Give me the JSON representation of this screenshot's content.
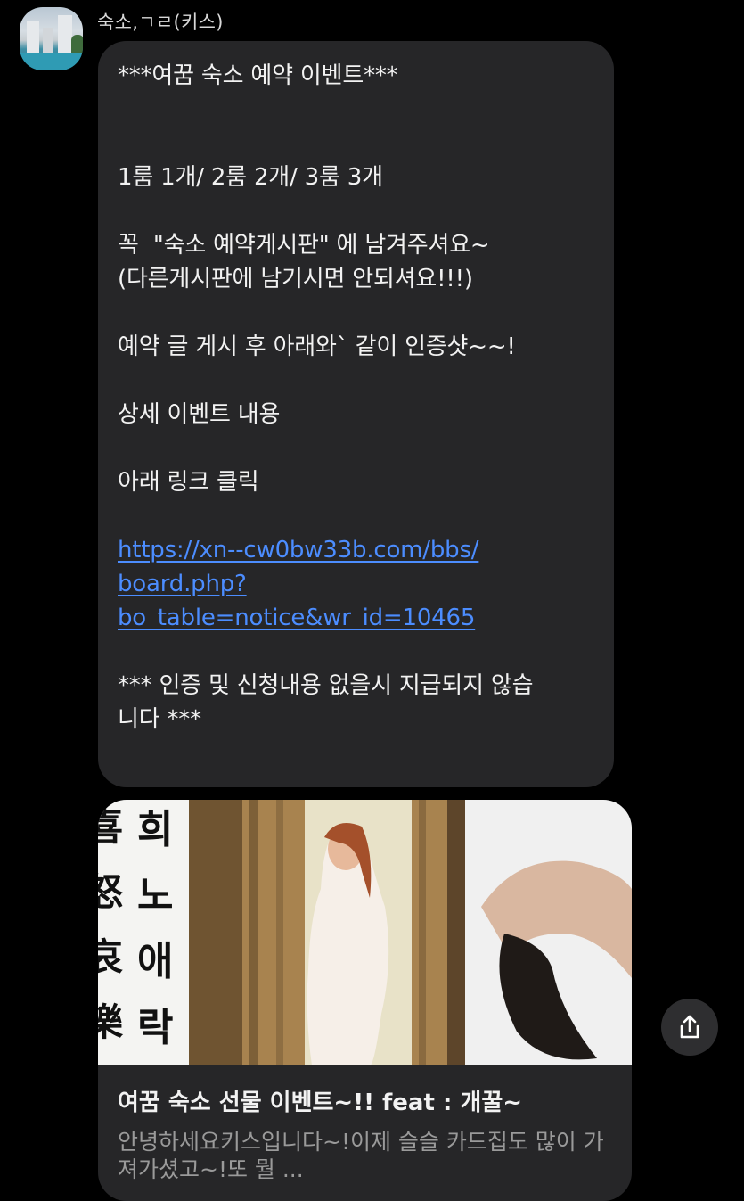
{
  "sender": {
    "name": "숙소,ㄱㄹ(키스)"
  },
  "message": {
    "title": "***여꿈 숙소 예약 이벤트***",
    "rooms": "1룸 1개/ 2룸 2개/ 3룸 3개",
    "instruction_1": "꼭  \"숙소 예약게시판\" 에 남겨주셔요~",
    "instruction_2": "(다른게시판에 남기시면 안되셔요!!!)",
    "instruction_3": "예약 글 게시 후 아래와` 같이 인증샷~~!",
    "details": "상세 이벤트 내용",
    "click": "아래 링크 클릭",
    "link_line_1": "https://xn--cw0bw33b.com/bbs/",
    "link_line_2": "board.php?",
    "link_line_3": "bo_table=notice&wr_id=10465",
    "notice_line_1": "*** 인증 및 신청내용 없을시 지급되지 않습",
    "notice_line_2": "니다 ***"
  },
  "link_preview": {
    "calligraphy_left": [
      "喜",
      "怒",
      "哀",
      "樂"
    ],
    "calligraphy_right": [
      "희",
      "노",
      "애",
      "락"
    ],
    "title": "여꿈 숙소 선물 이벤트~!! feat : 개꿀~",
    "description": "안녕하세요키스입니다~!이제 슬슬 카드집도 많이 가져가셨고~!또 뭘 ..."
  },
  "icons": {
    "share": "share-icon"
  },
  "colors": {
    "bubble": "#262628",
    "link": "#4c8dff",
    "background": "#000000"
  }
}
